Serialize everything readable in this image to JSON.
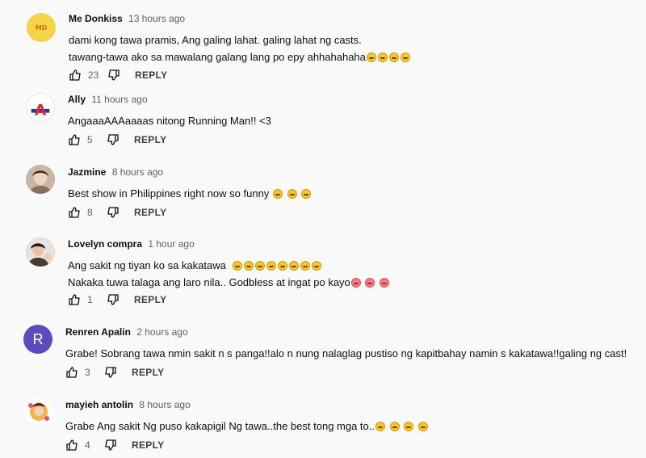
{
  "comments": [
    {
      "author": "Me Donkiss",
      "time": "13 hours ago",
      "avatar_text": "",
      "avatar_color": "#f7d34a",
      "lines": [
        "dami kong tawa pramis, Ang galing lahat. galing lahat ng casts.",
        "tawang-tawa ako sa mawalang galang lang  po epy ahhahahaha"
      ],
      "likes": "23",
      "reply": "REPLY"
    },
    {
      "author": "Ally",
      "time": "11 hours ago",
      "avatar_text": "A",
      "avatar_color": "#ffffff",
      "lines": [
        "AngaaaAAAaaaas nitong Running Man!! <3"
      ],
      "likes": "5",
      "reply": "REPLY"
    },
    {
      "author": "Jazmine",
      "time": "8 hours ago",
      "avatar_text": "",
      "avatar_color": "#b8a393",
      "lines": [
        "Best show in Philippines right now so funny"
      ],
      "likes": "8",
      "reply": "REPLY"
    },
    {
      "author": "Lovelyn compra",
      "time": "1 hour ago",
      "avatar_text": "",
      "avatar_color": "#7d6a60",
      "lines": [
        "Ang sakit ng tiyan ko sa kakatawa",
        "Nakaka tuwa talaga ang laro nila.. Godbless at ingat po kayo"
      ],
      "likes": "1",
      "reply": "REPLY"
    },
    {
      "author": "Renren Apalin",
      "time": "2 hours ago",
      "avatar_text": "R",
      "avatar_color": "#5c4bbd",
      "lines": [
        "Grabe! Sobrang tawa nmin sakit n s panga!!alo n nung nalaglag pustiso ng kapitbahay namin s kakatawa!!galing ng cast!"
      ],
      "likes": "3",
      "reply": "REPLY"
    },
    {
      "author": "mayieh antolin",
      "time": "8 hours ago",
      "avatar_text": "",
      "avatar_color": "#f3d6c7",
      "lines": [
        "Grabe Ang sakit Ng puso kakapigil Ng tawa..the best tong mga to.."
      ],
      "likes": "4",
      "reply": "REPLY"
    }
  ]
}
